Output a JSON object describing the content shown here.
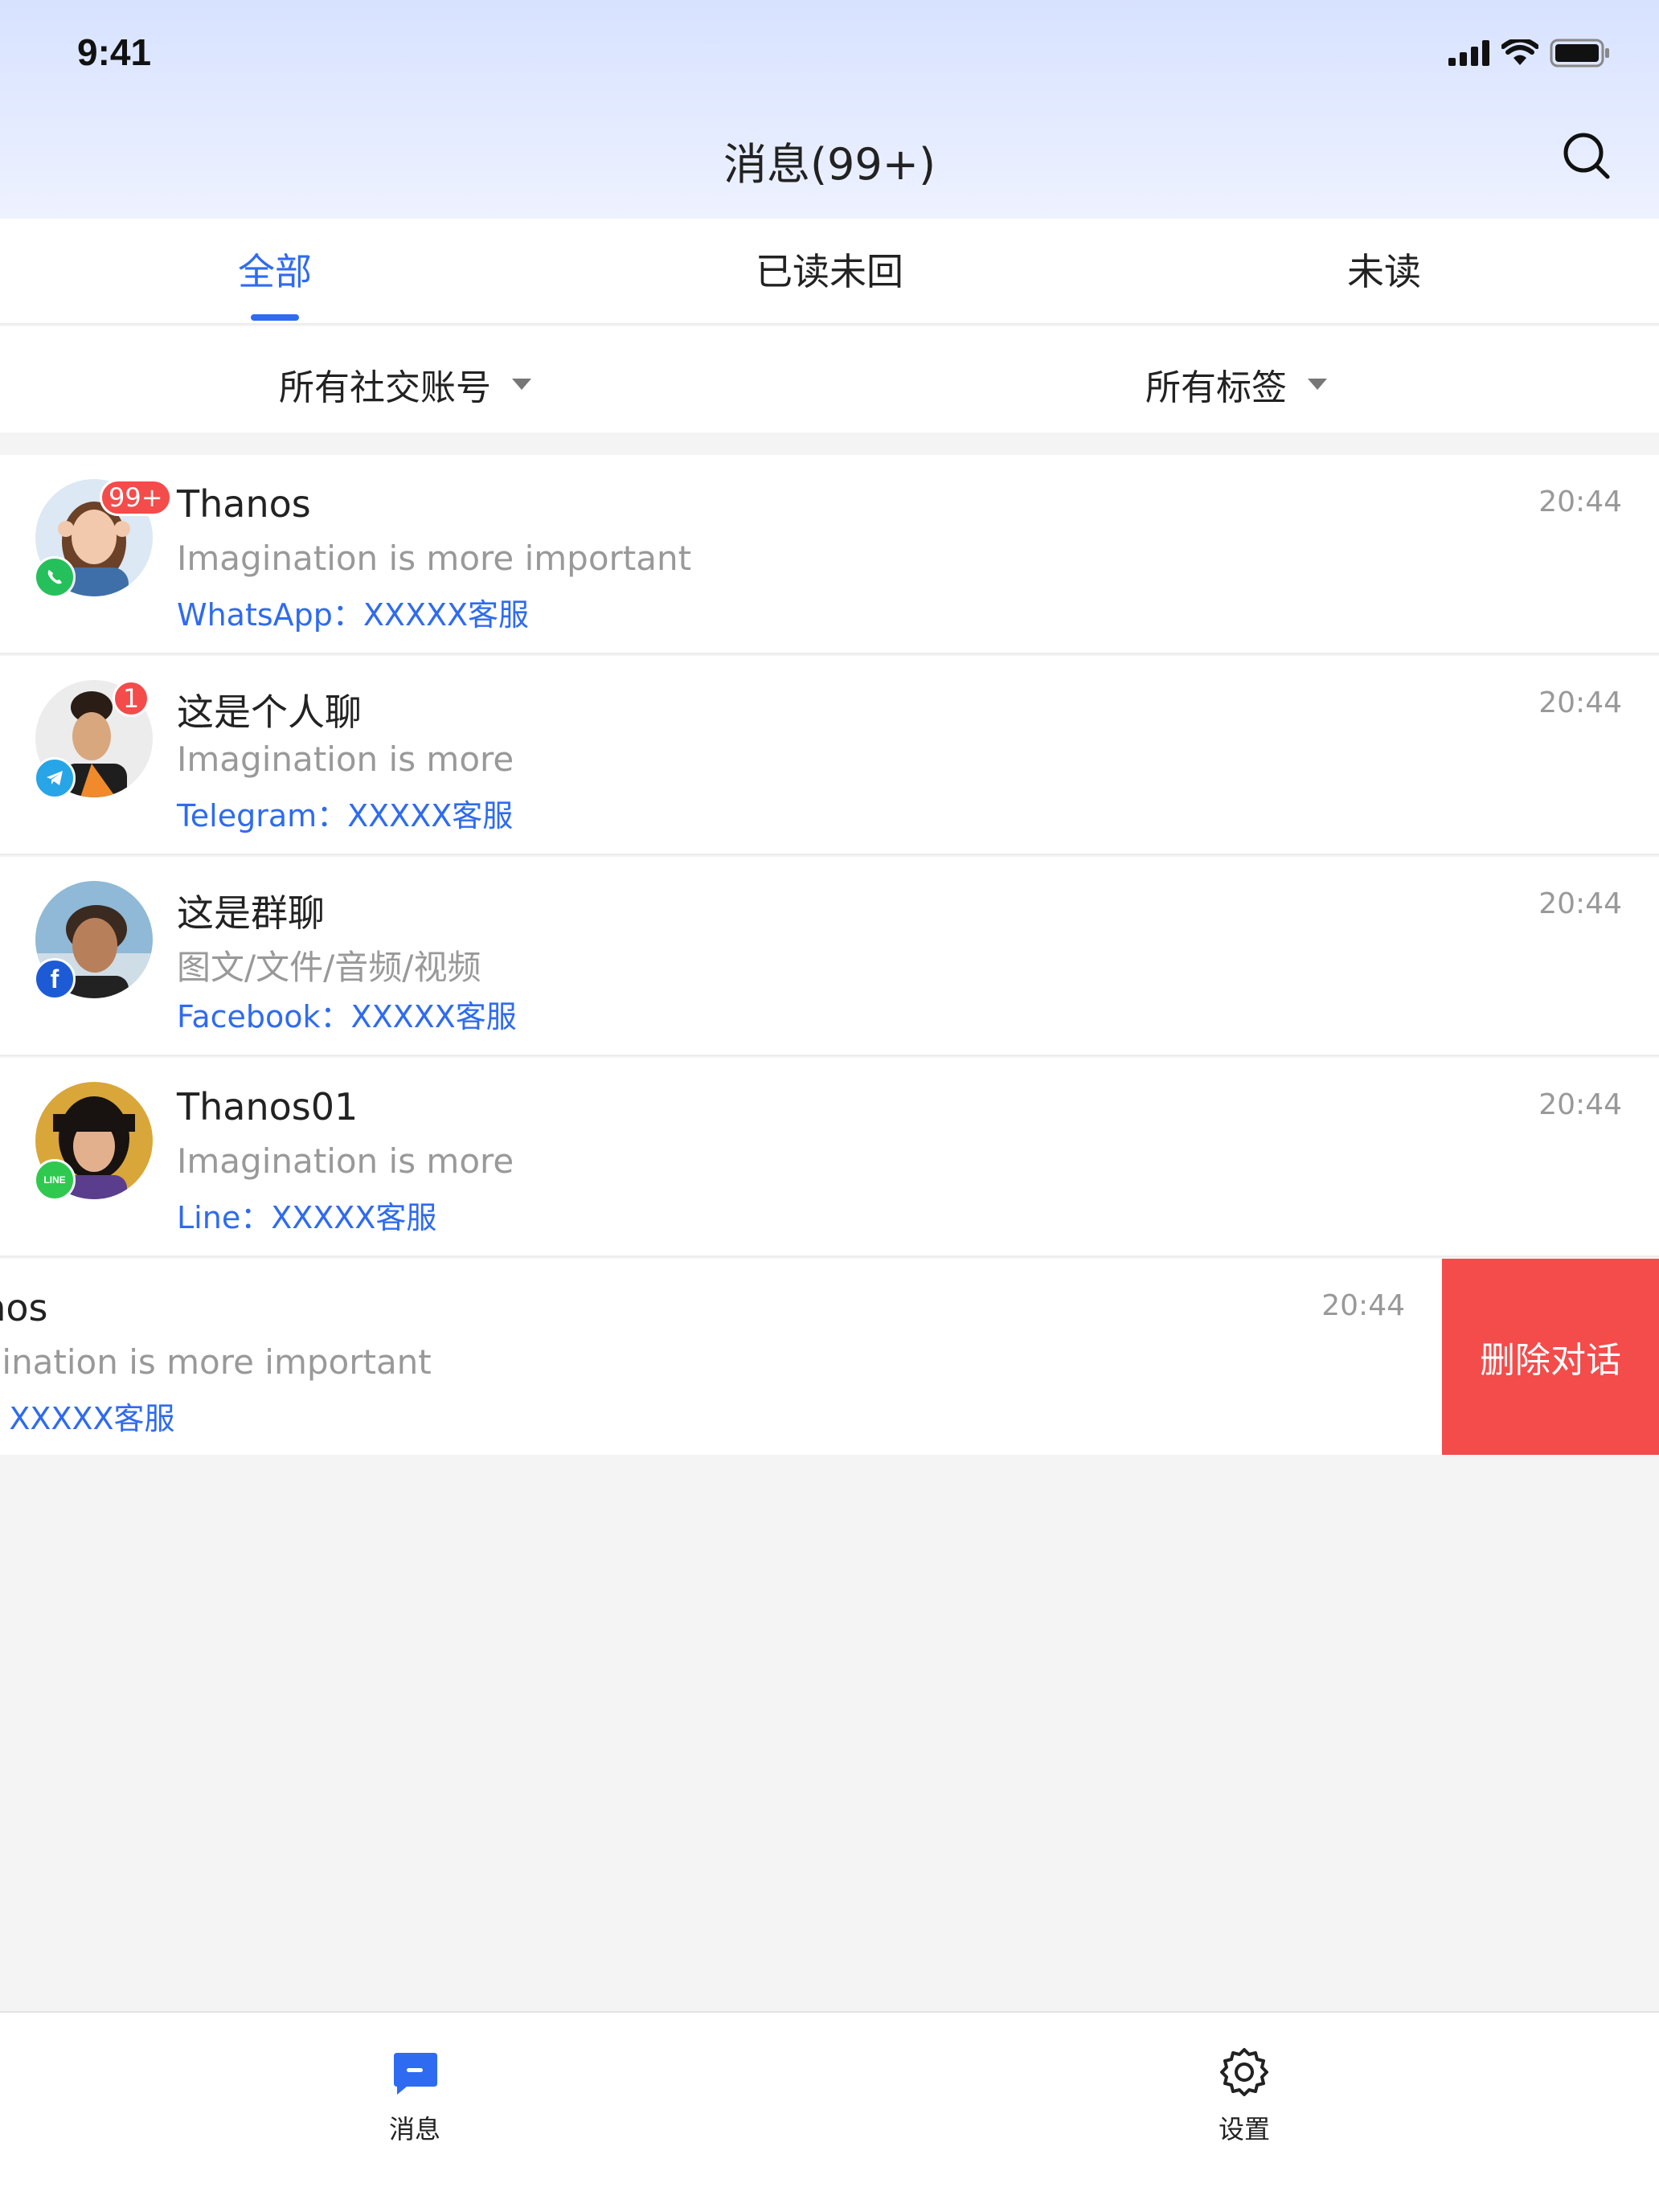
{
  "status_bar": {
    "time": "9:41"
  },
  "header": {
    "title": "消息(99+)"
  },
  "tabs": [
    {
      "label": "全部",
      "active": true
    },
    {
      "label": "已读未回",
      "active": false
    },
    {
      "label": "未读",
      "active": false
    }
  ],
  "filters": {
    "accounts": "所有社交账号",
    "tags": "所有标签"
  },
  "conversations": [
    {
      "name": "Thanos",
      "preview": "Imagination is more important",
      "source": "WhatsApp：XXXXX客服",
      "time": "20:44",
      "unread": "99+",
      "platform": "whatsapp-icon"
    },
    {
      "name": "这是个人聊",
      "preview": "Imagination is more",
      "source": "Telegram：XXXXX客服",
      "time": "20:44",
      "unread": "1",
      "platform": "telegram-icon"
    },
    {
      "name": "这是群聊",
      "preview": "图文/文件/音频/视频",
      "source": "Facebook：XXXXX客服",
      "time": "20:44",
      "unread": "",
      "platform": "facebook-icon"
    },
    {
      "name": "Thanos01",
      "preview": "Imagination is more",
      "source": "Line：XXXXX客服",
      "time": "20:44",
      "unread": "",
      "platform": "line-icon"
    }
  ],
  "swiped_conversation": {
    "name": "anos",
    "preview": "agination is more important",
    "source": "e：XXXXX客服",
    "time": "20:44",
    "delete_label": "删除对话"
  },
  "bottom_nav": [
    {
      "label": "消息",
      "icon": "message-icon",
      "active": true
    },
    {
      "label": "设置",
      "icon": "gear-icon",
      "active": false
    }
  ],
  "colors": {
    "accent": "#2f6bf0",
    "danger": "#f44b4b",
    "whatsapp": "#25c05b",
    "telegram": "#27a5e6",
    "facebook": "#1d5bd6",
    "line": "#2fc94f"
  }
}
